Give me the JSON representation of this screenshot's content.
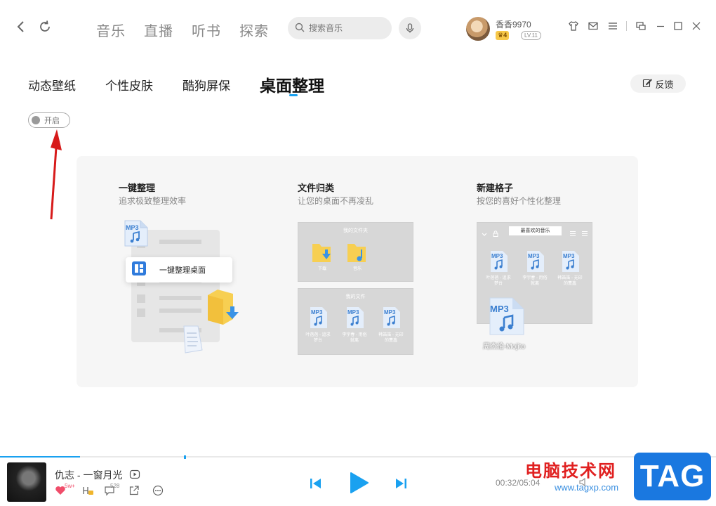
{
  "header": {
    "nav": [
      "音乐",
      "直播",
      "听书",
      "探索"
    ],
    "search_placeholder": "搜索音乐",
    "user": {
      "name": "香香9970",
      "vip": "4",
      "level": "LV.11"
    }
  },
  "tabs": [
    {
      "label": "动态壁纸"
    },
    {
      "label": "个性皮肤"
    },
    {
      "label": "酷狗屏保"
    },
    {
      "label": "桌面整理"
    }
  ],
  "feedback_label": "反馈",
  "toggle_label": "开启",
  "features": [
    {
      "title": "一键整理",
      "subtitle": "追求极致整理效率",
      "card_label": "一键整理桌面"
    },
    {
      "title": "文件归类",
      "subtitle": "让您的桌面不再凌乱",
      "box1_title": "我的文件夹",
      "box1_items": [
        "下载",
        "音乐"
      ],
      "box2_title": "我的文件"
    },
    {
      "title": "新建格子",
      "subtitle": "按您的喜好个性化整理",
      "box_title": "最喜欢的音乐",
      "big_file": "周杰伦-Mojito"
    }
  ],
  "files_small": [
    "叶蓓蓓 - 追求梦台",
    "李宇春 - 用俗就离",
    "韩笛笛 - 无印的薰鑫"
  ],
  "player": {
    "song": "仇志 - 一窗月光",
    "likes": "5w+",
    "comments": "528",
    "time": "00:32/05:04"
  },
  "watermark": {
    "cn": "电脑技术网",
    "url": "www.tagxp.com",
    "tag": "TAG"
  },
  "colors": {
    "accent": "#1aa1f0",
    "panel": "#f6f6f6"
  }
}
